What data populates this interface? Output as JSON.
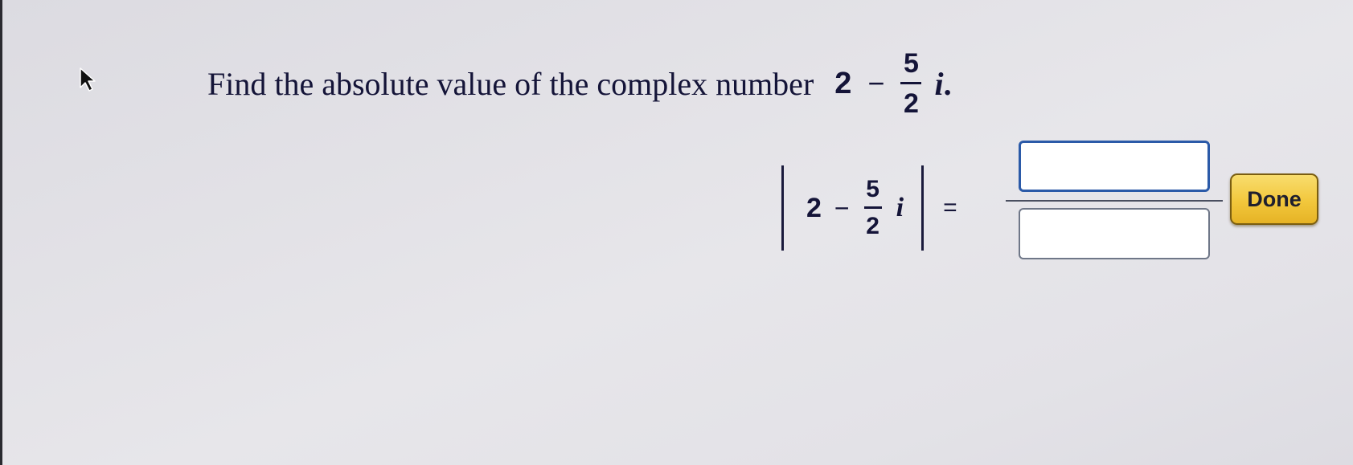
{
  "question": {
    "text": "Find the absolute value of the complex number",
    "expression": {
      "real": "2",
      "operator": "−",
      "numerator": "5",
      "denominator": "2",
      "imaginary_unit": "i",
      "terminator": "."
    }
  },
  "equation": {
    "real": "2",
    "operator": "−",
    "numerator": "5",
    "denominator": "2",
    "imaginary_unit": "i",
    "equals": "="
  },
  "answer": {
    "numerator_value": "",
    "denominator_value": ""
  },
  "done_button": {
    "label": "Done"
  },
  "icons": {
    "cursor": "mouse-pointer-icon"
  },
  "colors": {
    "text": "#141438",
    "input_border": "#2b5aa8",
    "button_fill": "#f2c73c"
  }
}
